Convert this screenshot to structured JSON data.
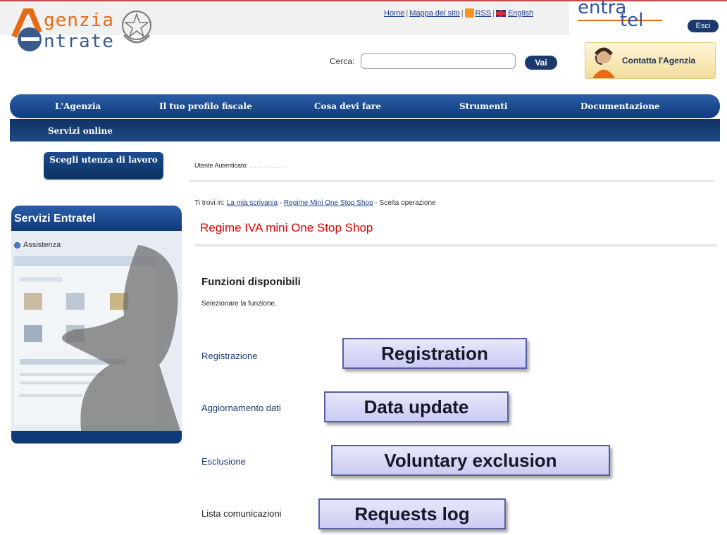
{
  "header": {
    "logo_word1": "genzia",
    "logo_word2": "ntrate",
    "links": {
      "home": "Home",
      "sitemap": "Mappa del sito",
      "rss": "RSS",
      "english": "English"
    },
    "entratel_word1": "entra",
    "entratel_word2": "tel",
    "exit_label": "Esci",
    "search_label": "Cerca:",
    "search_value": "",
    "search_button": "Vai",
    "contact_label": "Contatta l'Agenzia"
  },
  "nav": {
    "items": [
      "L'Agenzia",
      "Il tuo profilo fiscale",
      "Cosa devi fare",
      "Strumenti",
      "Documentazione"
    ],
    "sub_item": "Servizi online"
  },
  "toolbar": {
    "choose_label": "Scegli utenza di lavoro",
    "user_prefix": "Utente Autenticato:",
    "user_value": "..............."
  },
  "sidebar": {
    "title": "Servizi Entratel",
    "assist_label": "Assistenza"
  },
  "breadcrumb": {
    "prefix": "Ti trovi in:",
    "link1": "La mia scrivania",
    "sep1": " - ",
    "link2": "Regime Mini One Stop Shop",
    "sep2": " - ",
    "current": "Scelta operazione"
  },
  "main": {
    "title": "Regime IVA mini One Stop Shop",
    "functions_title": "Funzioni disponibili",
    "functions_sub": "Selezionare la funzione.",
    "functions": [
      {
        "label": "Registrazione",
        "callout": "Registration"
      },
      {
        "label": "Aggiornamento dati",
        "callout": "Data update"
      },
      {
        "label": "Esclusione",
        "callout": "Voluntary exclusion"
      },
      {
        "label": "Lista comunicazioni",
        "callout": "Requests log"
      }
    ]
  },
  "colors": {
    "nav_blue": "#0e3a78",
    "title_red": "#e00000",
    "logo_orange": "#e86a12",
    "callout_fill": "#c9cbf3"
  }
}
